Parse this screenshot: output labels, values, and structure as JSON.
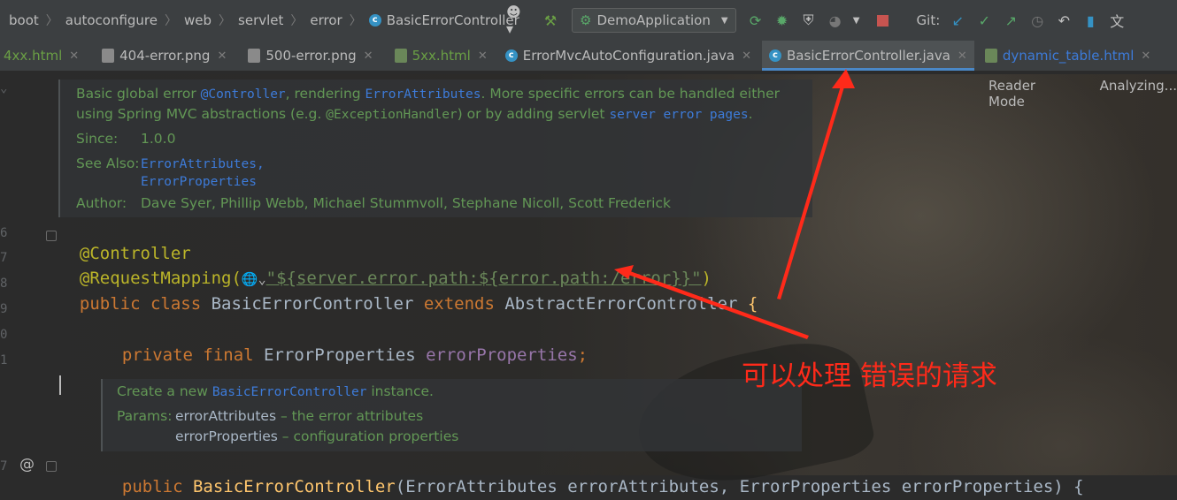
{
  "navbar": {
    "breadcrumbs": [
      "boot",
      "autoconfigure",
      "web",
      "servlet",
      "error",
      "BasicErrorController"
    ],
    "run_config": "DemoApplication",
    "git_label": "Git:"
  },
  "tabs": [
    {
      "label": "4xx.html",
      "type": "html"
    },
    {
      "label": "404-error.png",
      "type": "png"
    },
    {
      "label": "500-error.png",
      "type": "png"
    },
    {
      "label": "5xx.html",
      "type": "html"
    },
    {
      "label": "ErrorMvcAutoConfiguration.java",
      "type": "java"
    },
    {
      "label": "BasicErrorController.java",
      "type": "java",
      "active": true
    },
    {
      "label": "dynamic_table.html",
      "type": "html"
    }
  ],
  "editor_status": {
    "reader_mode": "Reader Mode",
    "analyzing": "Analyzing..."
  },
  "gutter": {
    "line_numbers": [
      "6",
      "7",
      "8",
      "9",
      "0",
      "1",
      "7"
    ]
  },
  "doc_class": {
    "text_1": "Basic global error ",
    "code_1": "@Controller",
    "text_2": ", rendering ",
    "code_2": "ErrorAttributes",
    "text_3": ". More specific errors can be handled either",
    "text_4": "using Spring MVC abstractions (e.g. ",
    "code_3": "@ExceptionHandler",
    "text_5": ") or by adding servlet ",
    "code_4": "server error pages",
    "text_6": ".",
    "since_label": "Since:",
    "since_value": "1.0.0",
    "see_also_label": "See Also:",
    "see_also_1": "ErrorAttributes,",
    "see_also_2": "ErrorProperties",
    "author_label": "Author:",
    "author_value": "Dave Syer, Phillip Webb, Michael Stummvoll, Stephane Nicoll, Scott Frederick"
  },
  "code": {
    "l1_ann": "@Controller",
    "l2_ann": "@RequestMapping(",
    "l2_str": "\"${server.error.path:${error.path:/error}}\"",
    "l2_close": ")",
    "l3_kw1": "public class ",
    "l3_name": "BasicErrorController ",
    "l3_kw2": "extends ",
    "l3_super": "AbstractErrorController ",
    "l3_brace": "{",
    "l5_kw": "private final ",
    "l5_type": "ErrorProperties ",
    "l5_field": "errorProperties",
    "l5_semi": ";",
    "l7_kw": "public ",
    "l7_name": "BasicErrorController",
    "l7_args": "(ErrorAttributes errorAttributes, ErrorProperties errorProperties) {"
  },
  "doc_ctor": {
    "text_1": "Create a new ",
    "code_1": "BasicErrorController",
    "text_2": " instance.",
    "params_label": "Params:",
    "p1_name": "errorAttributes",
    "p1_desc": " – the error attributes",
    "p2_name": "errorProperties",
    "p2_desc": " – configuration properties"
  },
  "annotation": {
    "text": "可以处理 错误的请求",
    "color": "#ff2a1a"
  }
}
